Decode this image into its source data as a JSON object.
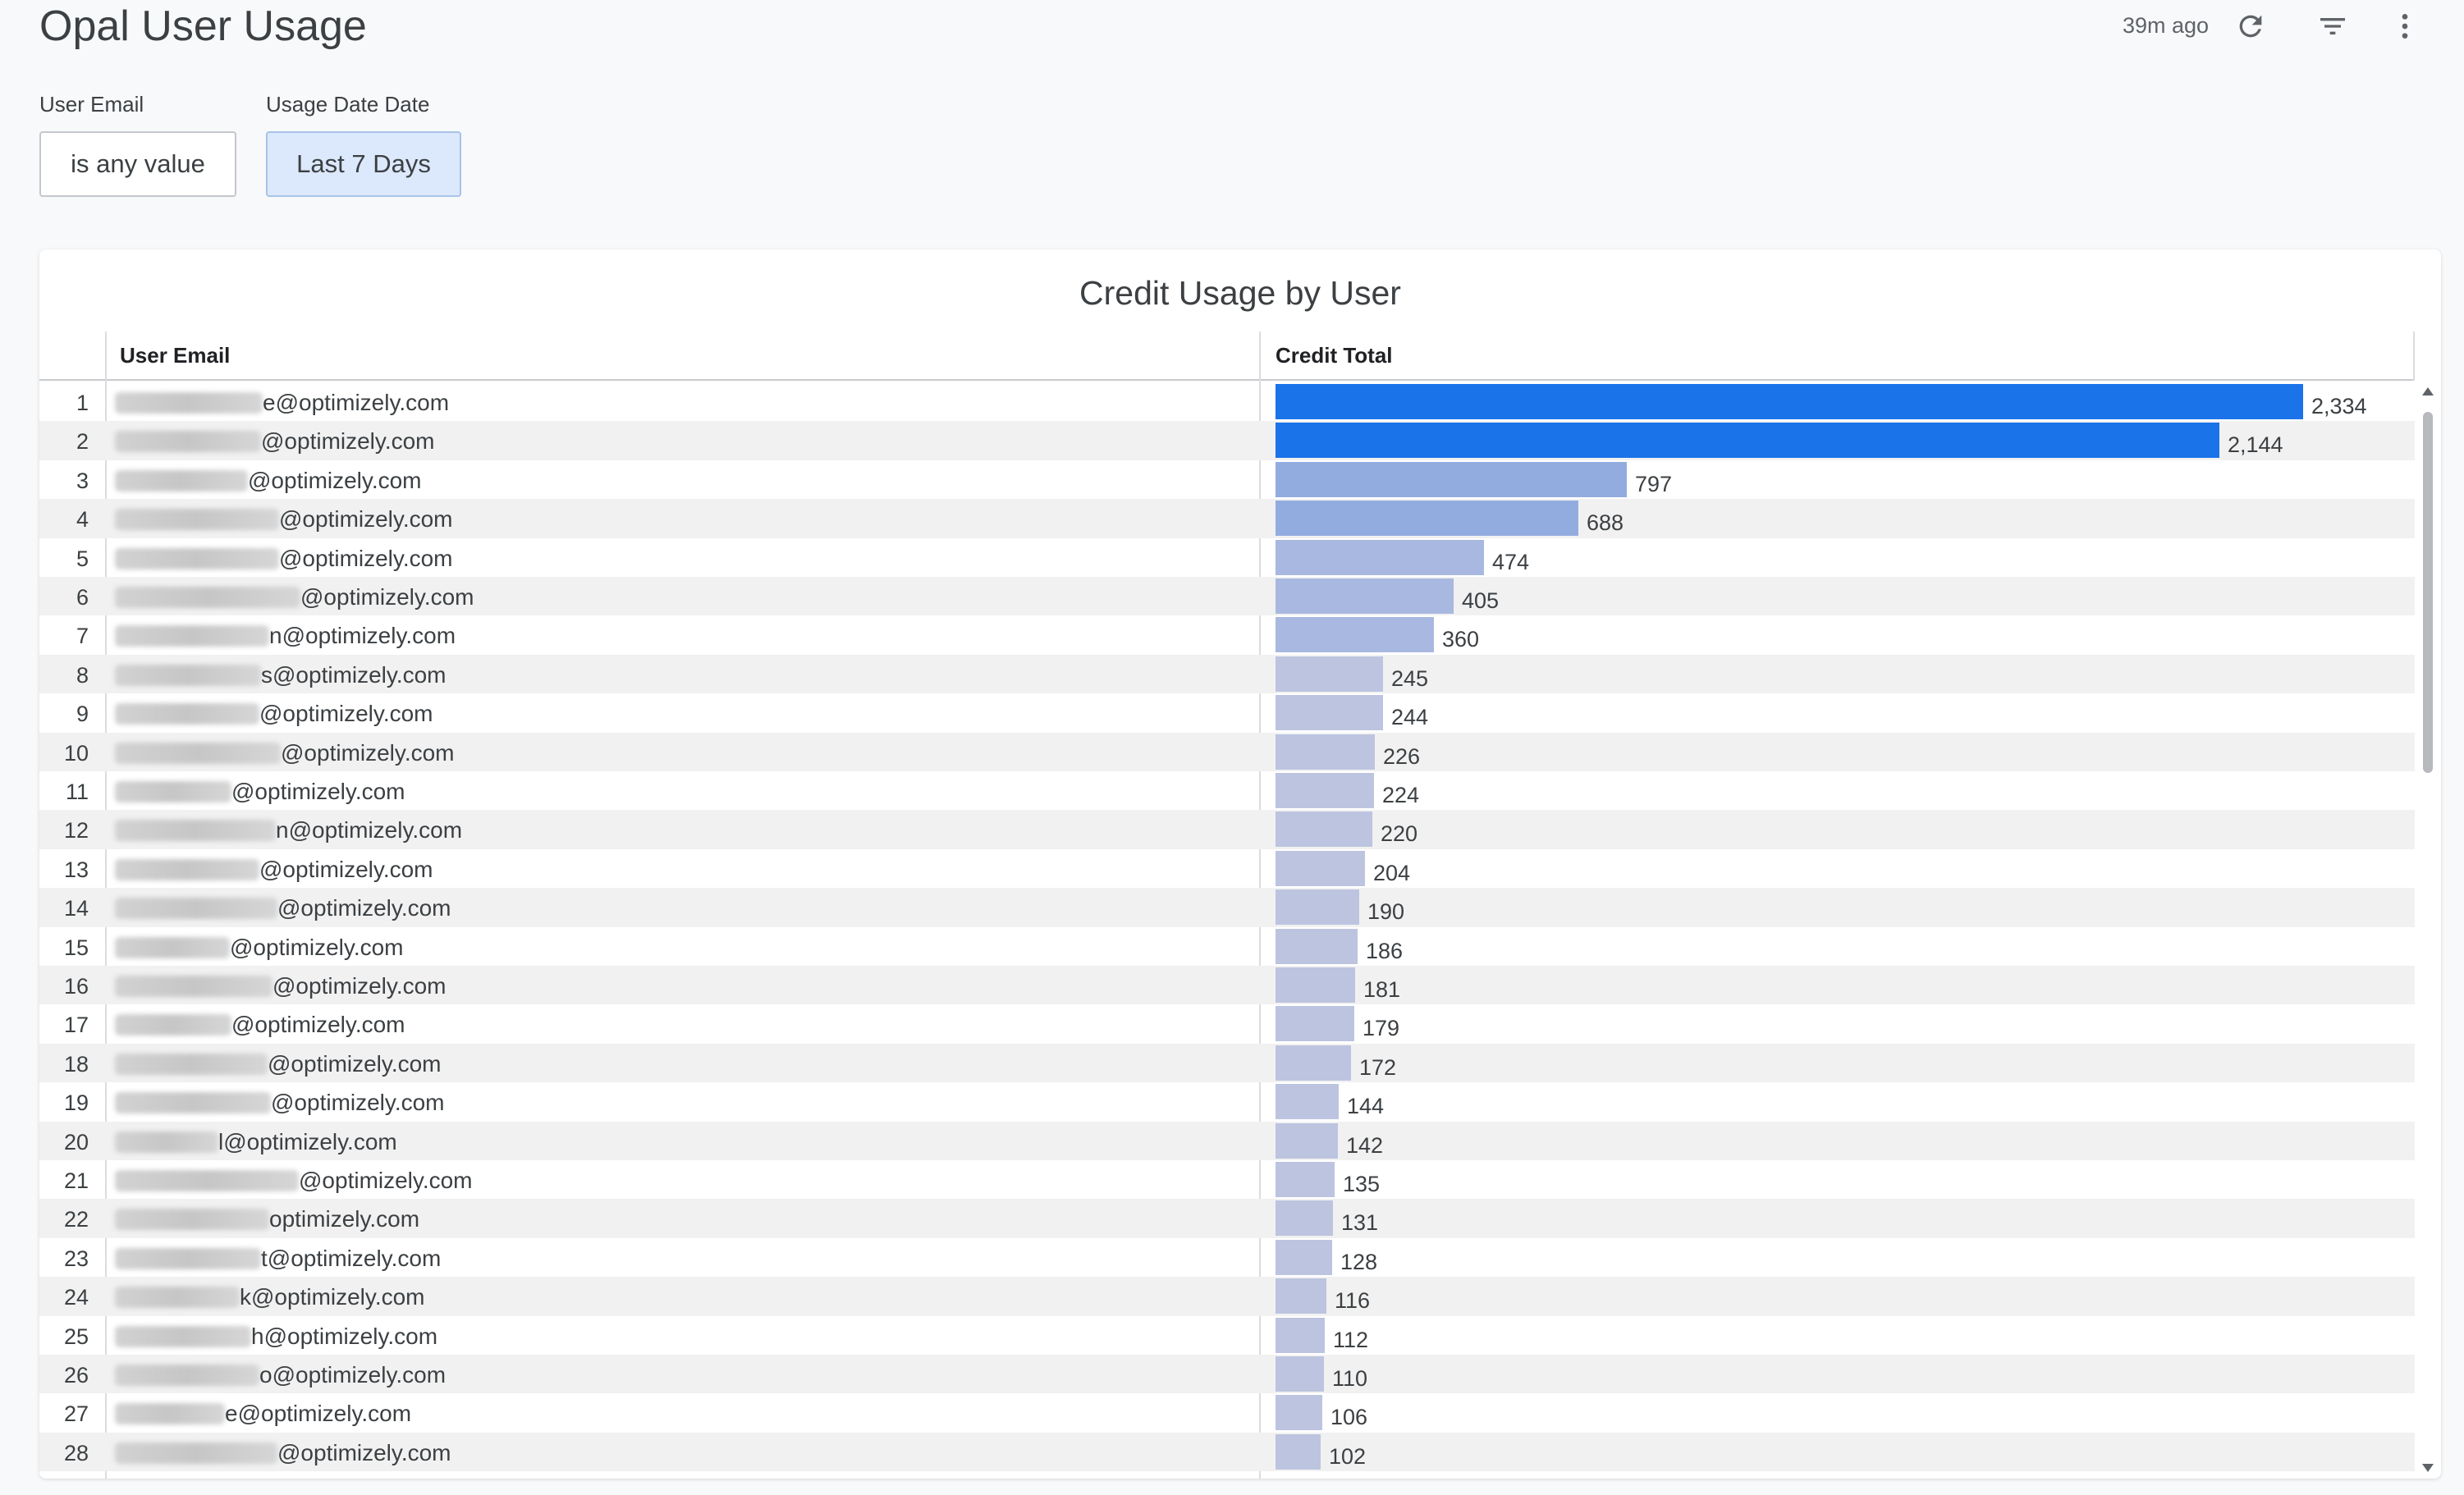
{
  "header": {
    "title": "Opal User Usage",
    "last_updated": "39m ago",
    "icons": [
      "refresh-icon",
      "filter-icon",
      "more-vert-icon"
    ]
  },
  "filters": [
    {
      "label": "User Email",
      "value": "is any value",
      "active": false
    },
    {
      "label": "Usage Date Date",
      "value": "Last 7 Days",
      "active": true
    }
  ],
  "tile": {
    "title": "Credit Usage by User",
    "columns": [
      "User Email",
      "Credit Total"
    ]
  },
  "colors": {
    "bar_top": "#1a73e8",
    "bar_mid": "#93acdf",
    "bar_low": "#bcc4e0"
  },
  "rows": [
    {
      "n": "1",
      "email": "e@optimizely.com",
      "credit": 2334,
      "credit_label": "2,334"
    },
    {
      "n": "2",
      "email": "@optimizely.com",
      "credit": 2144,
      "credit_label": "2,144"
    },
    {
      "n": "3",
      "email": "@optimizely.com",
      "credit": 797,
      "credit_label": "797"
    },
    {
      "n": "4",
      "email": "@optimizely.com",
      "credit": 688,
      "credit_label": "688"
    },
    {
      "n": "5",
      "email": "@optimizely.com",
      "credit": 474,
      "credit_label": "474"
    },
    {
      "n": "6",
      "email": "@optimizely.com",
      "credit": 405,
      "credit_label": "405"
    },
    {
      "n": "7",
      "email": "n@optimizely.com",
      "credit": 360,
      "credit_label": "360"
    },
    {
      "n": "8",
      "email": "s@optimizely.com",
      "credit": 245,
      "credit_label": "245"
    },
    {
      "n": "9",
      "email": "@optimizely.com",
      "credit": 244,
      "credit_label": "244"
    },
    {
      "n": "10",
      "email": "@optimizely.com",
      "credit": 226,
      "credit_label": "226"
    },
    {
      "n": "11",
      "email": "@optimizely.com",
      "credit": 224,
      "credit_label": "224"
    },
    {
      "n": "12",
      "email": "n@optimizely.com",
      "credit": 220,
      "credit_label": "220"
    },
    {
      "n": "13",
      "email": "@optimizely.com",
      "credit": 204,
      "credit_label": "204"
    },
    {
      "n": "14",
      "email": "@optimizely.com",
      "credit": 190,
      "credit_label": "190"
    },
    {
      "n": "15",
      "email": "@optimizely.com",
      "credit": 186,
      "credit_label": "186"
    },
    {
      "n": "16",
      "email": "@optimizely.com",
      "credit": 181,
      "credit_label": "181"
    },
    {
      "n": "17",
      "email": "@optimizely.com",
      "credit": 179,
      "credit_label": "179"
    },
    {
      "n": "18",
      "email": "@optimizely.com",
      "credit": 172,
      "credit_label": "172"
    },
    {
      "n": "19",
      "email": "@optimizely.com",
      "credit": 144,
      "credit_label": "144"
    },
    {
      "n": "20",
      "email": "l@optimizely.com",
      "credit": 142,
      "credit_label": "142"
    },
    {
      "n": "21",
      "email": "@optimizely.com",
      "credit": 135,
      "credit_label": "135"
    },
    {
      "n": "22",
      "email": "optimizely.com",
      "credit": 131,
      "credit_label": "131"
    },
    {
      "n": "23",
      "email": "t@optimizely.com",
      "credit": 128,
      "credit_label": "128"
    },
    {
      "n": "24",
      "email": "k@optimizely.com",
      "credit": 116,
      "credit_label": "116"
    },
    {
      "n": "25",
      "email": "h@optimizely.com",
      "credit": 112,
      "credit_label": "112"
    },
    {
      "n": "26",
      "email": "o@optimizely.com",
      "credit": 110,
      "credit_label": "110"
    },
    {
      "n": "27",
      "email": "e@optimizely.com",
      "credit": 106,
      "credit_label": "106"
    },
    {
      "n": "28",
      "email": "@optimizely.com",
      "credit": 102,
      "credit_label": "102"
    }
  ]
}
